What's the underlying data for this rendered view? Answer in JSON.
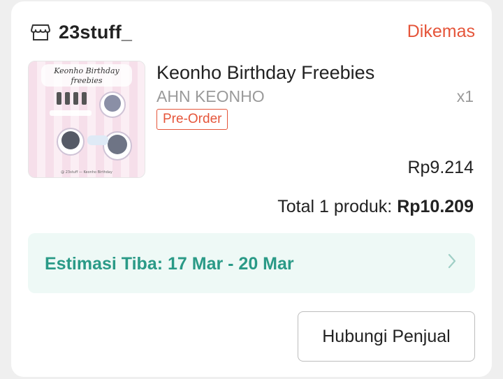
{
  "shop": {
    "name": "23stuff_",
    "icon": "store-icon",
    "status": "Dikemas",
    "status_color": "#e5553a"
  },
  "product": {
    "title": "Keonho Birthday Freebies",
    "variant": "AHN KEONHO",
    "quantity": "x1",
    "badge": "Pre-Order",
    "price": "Rp9.214",
    "image": {
      "title_line1": "Keonho Birthday",
      "title_line2": "freebies",
      "footer": "@ 23stuff — Keonho Birthday"
    }
  },
  "summary": {
    "total_label": "Total 1 produk:",
    "total_value": "Rp10.209"
  },
  "estimate": {
    "text": "Estimasi Tiba: 17 Mar - 20 Mar",
    "icon": "chevron-right-icon"
  },
  "actions": {
    "contact_label": "Hubungi Penjual"
  },
  "colors": {
    "accent": "#e5553a",
    "teal": "#2a9a87",
    "teal_bg": "#eef9f6"
  }
}
